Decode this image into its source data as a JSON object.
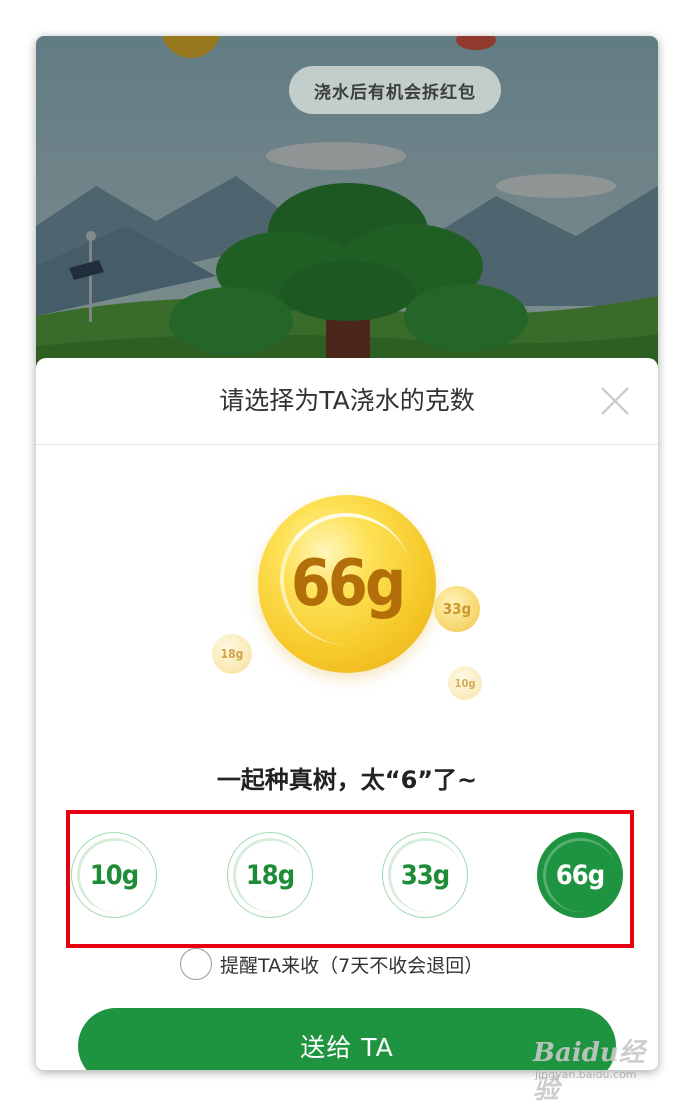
{
  "scene": {
    "tip": "浇水后有机会拆红包"
  },
  "sheet": {
    "title": "请选择为TA浇水的克数",
    "close_icon": "close-icon"
  },
  "orbs": {
    "main": "66g",
    "small_right": "33g",
    "small_left": "18g",
    "small_bottom": "10g"
  },
  "slogan": "一起种真树，太“6”了~",
  "amounts": [
    {
      "label": "10g",
      "selected": false
    },
    {
      "label": "18g",
      "selected": false
    },
    {
      "label": "33g",
      "selected": false
    },
    {
      "label": "66g",
      "selected": true
    }
  ],
  "remind": {
    "label": "提醒TA来收（7天不收会退回）",
    "checked": false
  },
  "send_button": "送给 TA",
  "watermark": {
    "logo": "Baidu经验",
    "site": "jingyan.baidu.com"
  },
  "colors": {
    "accent": "#1f9440",
    "highlight": "#e60012",
    "orb_gold": "#f6c92a"
  }
}
